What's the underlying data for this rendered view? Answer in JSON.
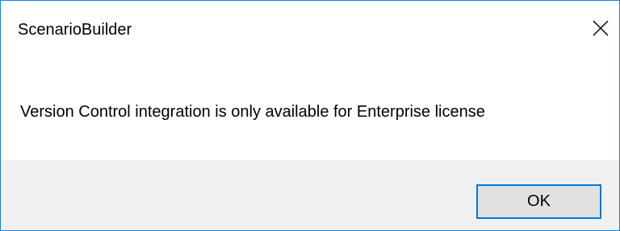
{
  "window": {
    "title": "ScenarioBuilder",
    "close_icon": "close-icon",
    "border_color": "#1883d7"
  },
  "message": {
    "text": "Version Control integration is only available for Enterprise license"
  },
  "buttons": {
    "ok_label": "OK",
    "ok_border_color": "#0078d7"
  },
  "footer": {
    "background": "#f0f0f0"
  }
}
